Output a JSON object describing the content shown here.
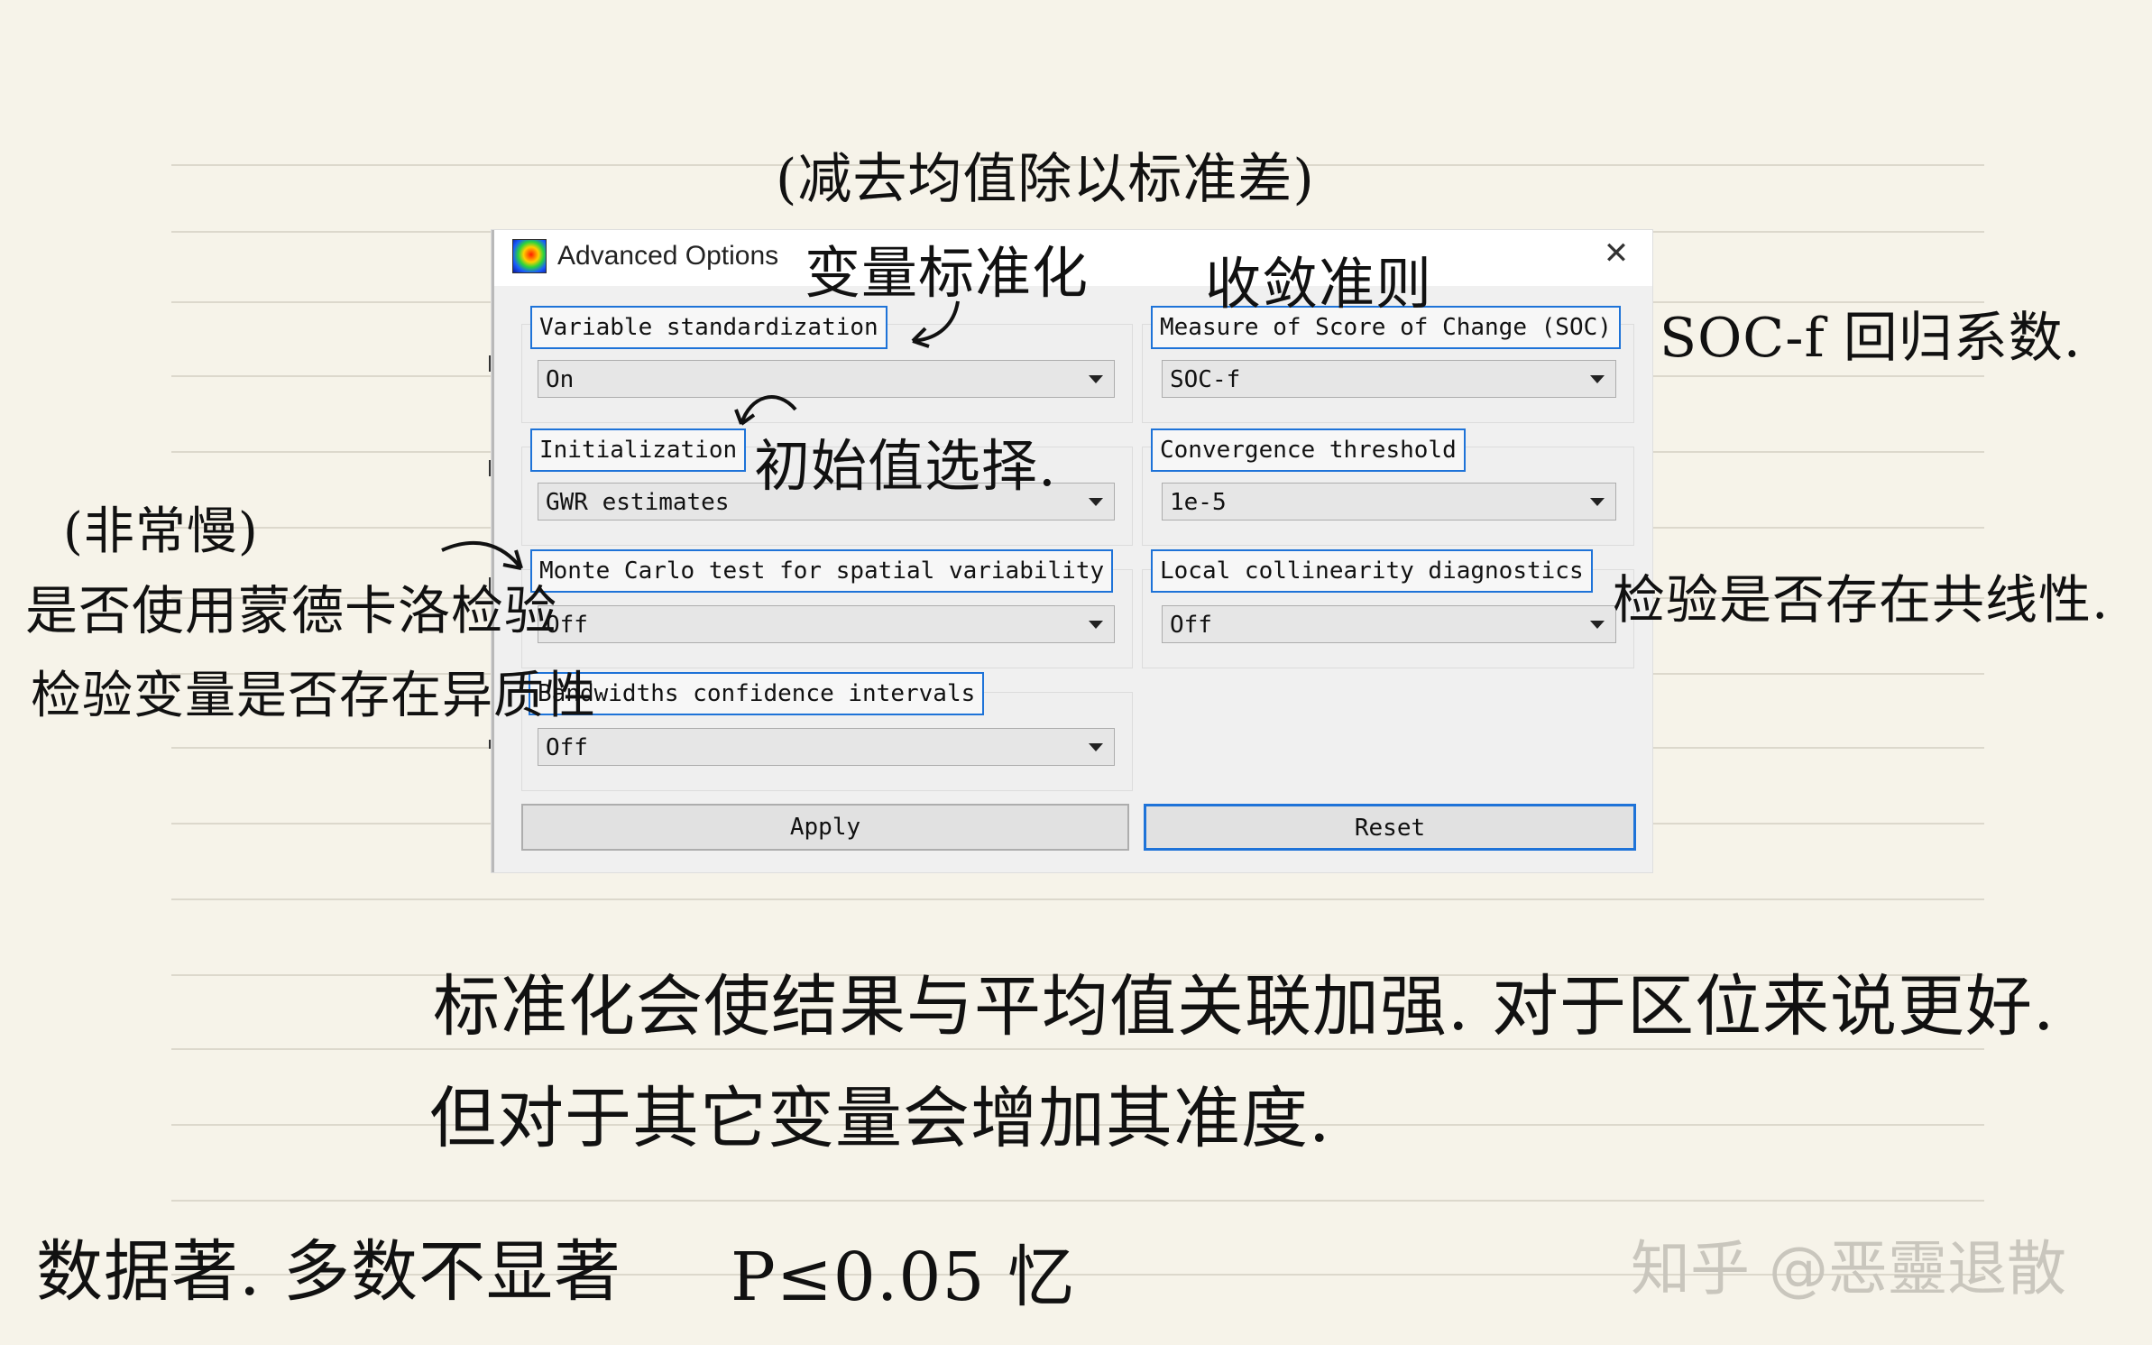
{
  "dialog": {
    "title": "Advanced Options",
    "close_symbol": "✕",
    "fields": {
      "variable_standardization": {
        "label": "Variable standardization",
        "value": "On"
      },
      "initialization": {
        "label": "Initialization",
        "value": "GWR estimates"
      },
      "monte_carlo": {
        "label": "Monte Carlo test for spatial variability",
        "value": "Off"
      },
      "bandwidth_ci": {
        "label": "Bandwidths confidence intervals",
        "value": "Off"
      },
      "soc": {
        "label": "Measure of Score of Change (SOC)",
        "value": "SOC-f"
      },
      "convergence": {
        "label": "Convergence threshold",
        "value": "1e-5"
      },
      "collinearity": {
        "label": "Local collinearity diagnostics",
        "value": "Off"
      }
    },
    "buttons": {
      "apply": "Apply",
      "reset": "Reset"
    }
  },
  "annotations": {
    "subtract_mean": "(减去均值除以标准差)",
    "var_std": "变量标准化",
    "convergence_rule": "收敛准则",
    "soc_note": "SOC-f 回归系数.",
    "init_choice": "初始值选择.",
    "very_slow": "(非常慢)",
    "use_monte_carlo": "是否使用蒙德卡洛检验",
    "check_heterogeneity": "检验变量是否存在异质性",
    "check_collinearity": "检验是否存在共线性.",
    "para1_line1": "标准化会使结果与平均值关联加强. 对于区位来说更好.",
    "para1_line2": "但对于其它变量会增加其准度.",
    "data_significant": "数据著. 多数不显著",
    "p_value": "P≤0.05 忆"
  },
  "watermark": "知乎 @恶靈退散"
}
